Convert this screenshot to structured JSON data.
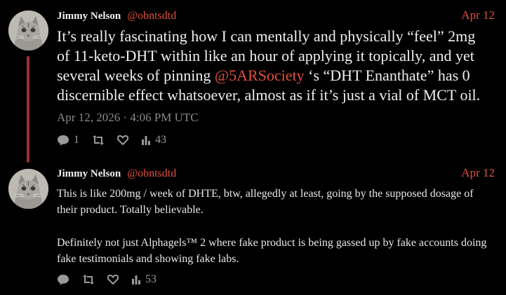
{
  "posts": [
    {
      "author": "Jimmy Nelson",
      "handle": "@obntsdtd",
      "date": "Apr 12",
      "body_before": "It’s really fascinating how I can mentally and physically “feel” 2mg of 11-keto-DHT within like an hour of applying it topically, and yet several weeks of pinning ",
      "mention": "@5ARSociety",
      "body_after": " ‘s “DHT Enanthate” has 0 discernible effect whatsoever, almost as if it’s just a vial of MCT oil.",
      "timestamp": "Apr 12, 2026 · 4:06 PM UTC",
      "replies": "1",
      "stats": "43"
    },
    {
      "author": "Jimmy Nelson",
      "handle": "@obntsdtd",
      "date": "Apr 12",
      "para1": "This is like 200mg / week of DHTE, btw, allegedly at least, going by the supposed dosage of their product. Totally believable.",
      "para2": "Definitely not just Alphagels™ 2 where fake product is being gassed up by fake accounts doing fake testimonials and showing fake labs.",
      "stats": "53"
    }
  ],
  "colors": {
    "accent": "#e0503e",
    "thread": "#a03030",
    "muted": "#8a8a8a",
    "background": "#000000"
  },
  "icons": [
    "comment-icon",
    "retweet-icon",
    "heart-icon",
    "stats-icon"
  ]
}
